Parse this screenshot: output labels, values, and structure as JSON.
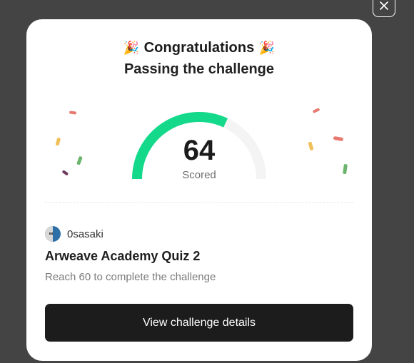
{
  "modal": {
    "close_icon": "close-icon",
    "title_text": "Congratulations",
    "title_emoji_left": "🎉",
    "title_emoji_right": "🎉",
    "subtitle": "Passing the challenge"
  },
  "result": {
    "score": "64",
    "score_label": "Scored",
    "progress_fraction": 0.64,
    "colors": {
      "progress": "#15d98a",
      "track": "#f4f4f4"
    }
  },
  "challenge": {
    "username": "0sasaki",
    "title": "Arweave Academy Quiz 2",
    "description": "Reach 60 to complete the challenge",
    "cta_label": "View challenge details"
  }
}
